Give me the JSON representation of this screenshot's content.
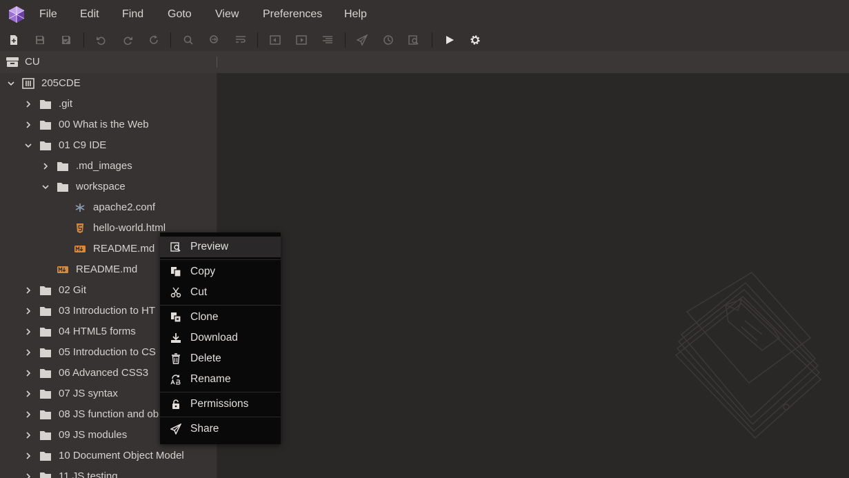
{
  "menubar": {
    "items": [
      "File",
      "Edit",
      "Find",
      "Goto",
      "View",
      "Preferences",
      "Help"
    ]
  },
  "toolbar": {
    "buttons": [
      "new-file-icon",
      "save-icon",
      "save-all-icon",
      "undo-icon",
      "redo-icon",
      "refresh-icon",
      "find-icon",
      "find-replace-icon",
      "wrap-icon",
      "indent-left-icon",
      "indent-right-icon",
      "format-icon",
      "send-icon",
      "history-icon",
      "preview-icon",
      "run-icon",
      "settings-icon"
    ]
  },
  "pathbar": {
    "label": "CU"
  },
  "tree": {
    "root": "205CDE",
    "items": [
      {
        "label": ".git",
        "type": "folder",
        "expanded": false
      },
      {
        "label": "00 What is the Web",
        "type": "folder",
        "expanded": false
      },
      {
        "label": "01 C9 IDE",
        "type": "folder",
        "expanded": true
      },
      {
        "label": ".md_images",
        "type": "folder",
        "expanded": false
      },
      {
        "label": "workspace",
        "type": "folder",
        "expanded": true
      },
      {
        "label": "apache2.conf",
        "type": "config-file"
      },
      {
        "label": "hello-world.html",
        "type": "html-file"
      },
      {
        "label": "README.md",
        "type": "markdown-file"
      },
      {
        "label": "README.md",
        "type": "markdown-file"
      },
      {
        "label": "02 Git",
        "type": "folder",
        "expanded": false
      },
      {
        "label": "03 Introduction to HT",
        "type": "folder",
        "expanded": false
      },
      {
        "label": "04 HTML5 forms",
        "type": "folder",
        "expanded": false
      },
      {
        "label": "05 Introduction to CS",
        "type": "folder",
        "expanded": false
      },
      {
        "label": "06 Advanced CSS3",
        "type": "folder",
        "expanded": false
      },
      {
        "label": "07 JS syntax",
        "type": "folder",
        "expanded": false
      },
      {
        "label": "08 JS function and ob",
        "type": "folder",
        "expanded": false
      },
      {
        "label": "09 JS modules",
        "type": "folder",
        "expanded": false
      },
      {
        "label": "10 Document Object Model",
        "type": "folder",
        "expanded": false
      },
      {
        "label": "11 JS testing",
        "type": "folder",
        "expanded": false
      }
    ]
  },
  "context_menu": {
    "items": [
      "Preview",
      "Copy",
      "Cut",
      "Clone",
      "Download",
      "Delete",
      "Rename",
      "Permissions",
      "Share"
    ],
    "active": "Preview"
  },
  "colors": {
    "accent_logo": "#8b5cc4",
    "markdown_icon": "#d9893a",
    "html_icon": "#d9893a"
  }
}
